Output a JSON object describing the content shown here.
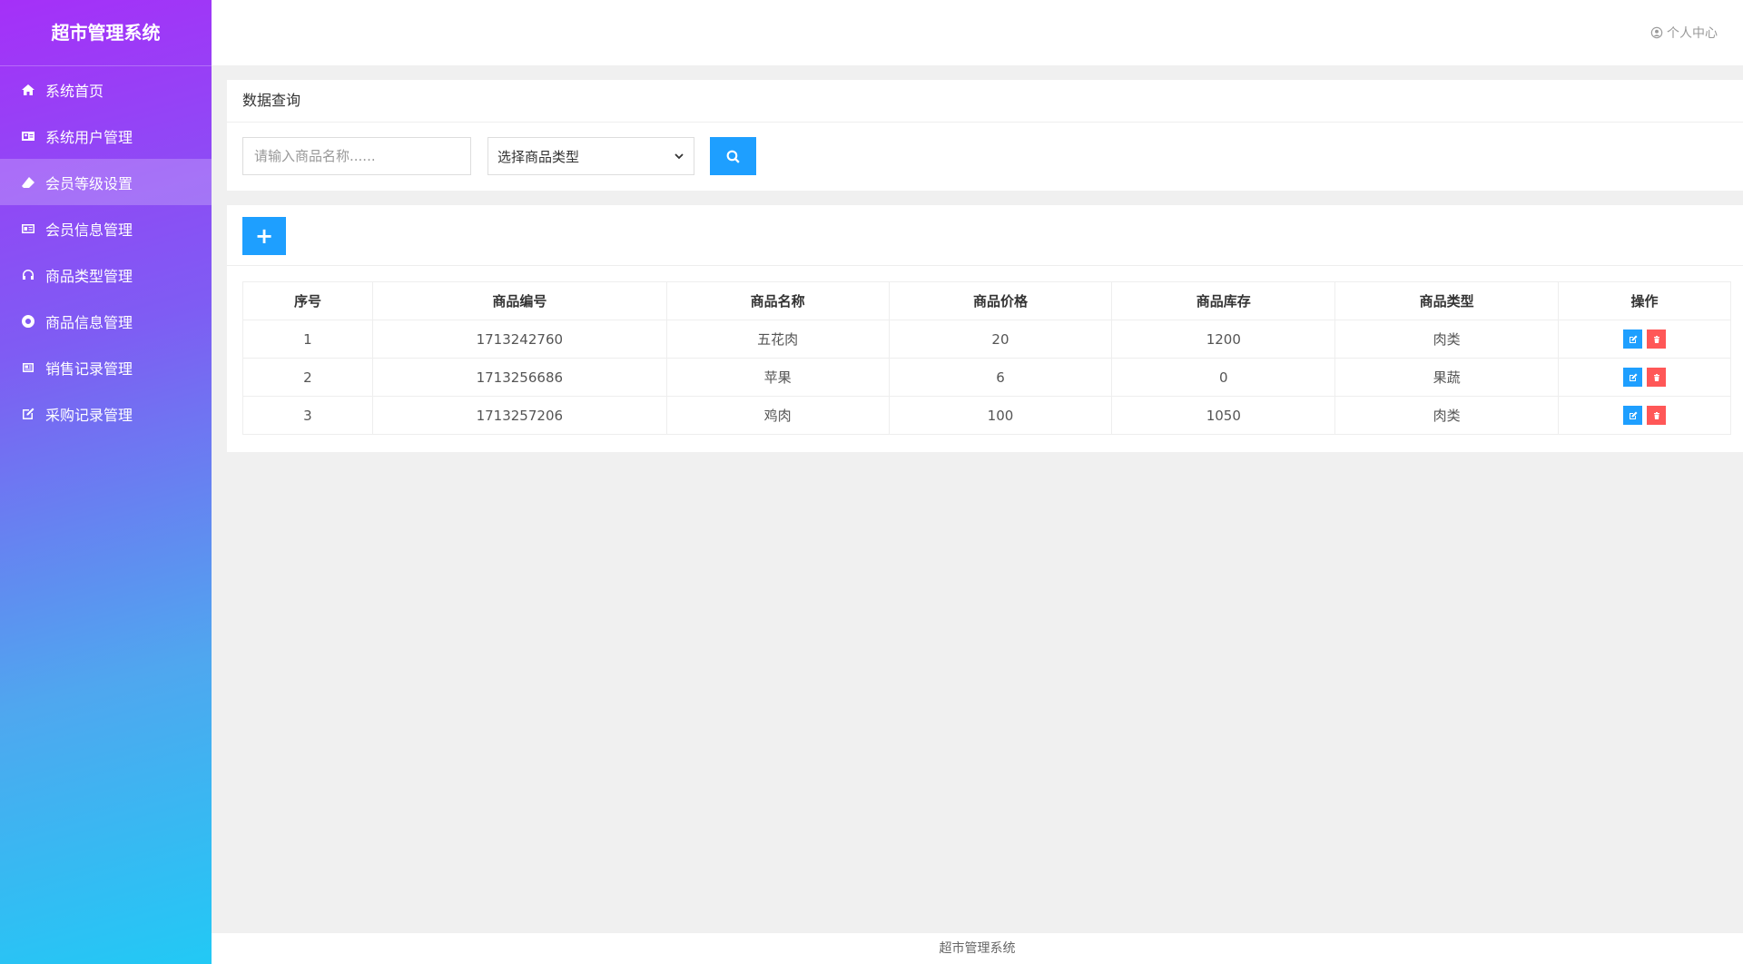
{
  "app": {
    "title": "超市管理系统"
  },
  "sidebar": {
    "items": [
      {
        "label": "系统首页",
        "icon": "home-icon"
      },
      {
        "label": "系统用户管理",
        "icon": "id-card-icon"
      },
      {
        "label": "会员等级设置",
        "icon": "eraser-icon",
        "active": true
      },
      {
        "label": "会员信息管理",
        "icon": "address-card-icon"
      },
      {
        "label": "商品类型管理",
        "icon": "headphones-icon"
      },
      {
        "label": "商品信息管理",
        "icon": "life-ring-icon"
      },
      {
        "label": "销售记录管理",
        "icon": "newspaper-icon"
      },
      {
        "label": "采购记录管理",
        "icon": "edit-square-icon"
      }
    ]
  },
  "header": {
    "user_center": "个人中心"
  },
  "search": {
    "title": "数据查询",
    "name_placeholder": "请输入商品名称......",
    "type_selected": "选择商品类型"
  },
  "table": {
    "add_label": "+",
    "columns": [
      "序号",
      "商品编号",
      "商品名称",
      "商品价格",
      "商品库存",
      "商品类型",
      "操作"
    ],
    "rows": [
      {
        "index": "1",
        "code": "1713242760",
        "name": "五花肉",
        "price": "20",
        "stock": "1200",
        "type": "肉类"
      },
      {
        "index": "2",
        "code": "1713256686",
        "name": "苹果",
        "price": "6",
        "stock": "0",
        "type": "果蔬"
      },
      {
        "index": "3",
        "code": "1713257206",
        "name": "鸡肉",
        "price": "100",
        "stock": "1050",
        "type": "肉类"
      }
    ]
  },
  "footer": {
    "text": "超市管理系统"
  },
  "colors": {
    "primary": "#1e9fff",
    "danger": "#ff5757",
    "sidebar_top": "#a530f8",
    "sidebar_bottom": "#22c9f5"
  }
}
